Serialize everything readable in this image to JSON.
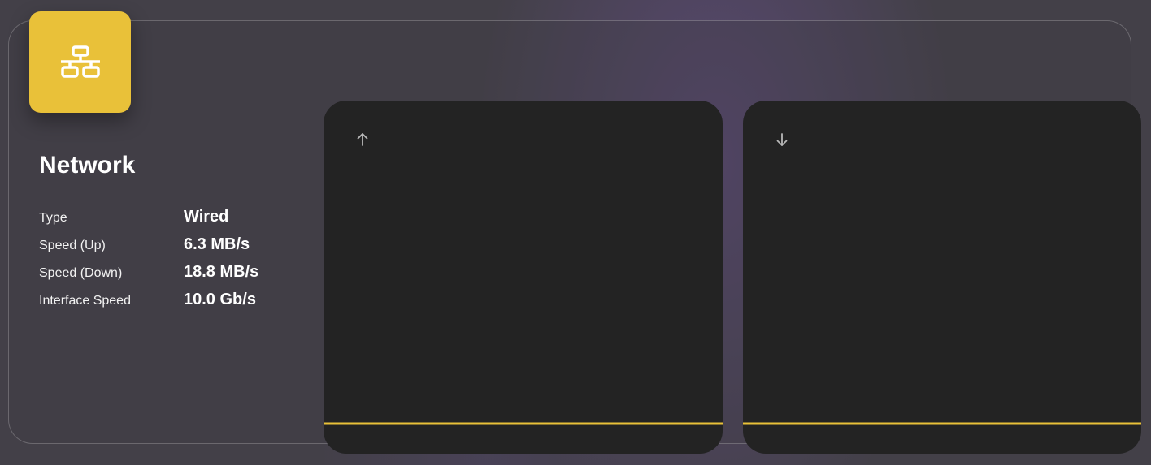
{
  "widget": {
    "title": "Network",
    "icon": "network-icon",
    "accent_color": "#e9c139",
    "stats": [
      {
        "label": "Type",
        "value": "Wired"
      },
      {
        "label": "Speed (Up)",
        "value": "6.3 MB/s"
      },
      {
        "label": "Speed (Down)",
        "value": "18.8 MB/s"
      },
      {
        "label": "Interface Speed",
        "value": "10.0 Gb/s"
      }
    ]
  },
  "graphs": {
    "upload": {
      "icon": "arrow-up-icon",
      "line_color": "#e9c139"
    },
    "download": {
      "icon": "arrow-down-icon",
      "line_color": "#e9c139"
    }
  }
}
